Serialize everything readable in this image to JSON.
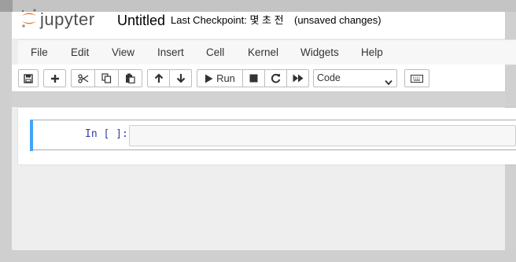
{
  "app": {
    "logo_text": "jupyter",
    "notebook_title": "Untitled",
    "checkpoint_text": "Last Checkpoint: 몇 초 전",
    "unsaved_text": "(unsaved changes)"
  },
  "menubar": {
    "items": [
      "File",
      "Edit",
      "View",
      "Insert",
      "Cell",
      "Kernel",
      "Widgets",
      "Help"
    ]
  },
  "toolbar": {
    "run_label": "Run",
    "cell_type": "Code",
    "icons": [
      "save-icon",
      "plus-icon",
      "scissors-icon",
      "copy-icon",
      "paste-icon",
      "arrow-up-icon",
      "arrow-down-icon",
      "play-icon",
      "stop-icon",
      "restart-icon",
      "fast-forward-icon",
      "chevron-down-icon",
      "keyboard-icon"
    ]
  },
  "cell": {
    "prompt": "In [ ]:",
    "source": ""
  },
  "colors": {
    "cell_selected": "#42a5f5",
    "prompt": "#303f9f",
    "logo_orange": "#f37626"
  }
}
